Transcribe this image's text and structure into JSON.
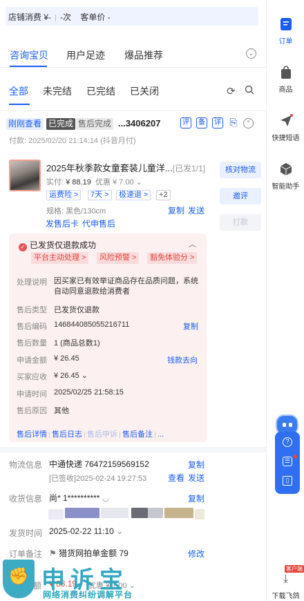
{
  "topbar": {
    "text1": "店铺消费 ¥-",
    "text2": "-次",
    "text3": "客单价 -"
  },
  "main_tabs": [
    {
      "label": "咨询宝贝",
      "active": true
    },
    {
      "label": "用户足迹",
      "active": false
    },
    {
      "label": "爆品推荐",
      "active": false
    }
  ],
  "order_tabs": [
    {
      "label": "全部",
      "active": true
    },
    {
      "label": "未完结",
      "active": false
    },
    {
      "label": "已完结",
      "active": false
    },
    {
      "label": "已关闭",
      "active": false
    }
  ],
  "order": {
    "badges": [
      "刚刚查看",
      "已完成",
      "售后完成"
    ],
    "order_no": "...3406207",
    "action_icons": [
      "评",
      "备",
      "详"
    ],
    "pay_time": "付款: 2025/02/20 21:14:14 (抖音月付)"
  },
  "product": {
    "title": "2025年秋季款女童套装儿童洋...",
    "shipped": "[已发1/1]",
    "price_label": "实付:",
    "price": "¥ 88.19",
    "discount": "优惠 ¥ 7.00",
    "tags": [
      "运费险 >",
      "7天 >",
      "极速退 >",
      "+2"
    ],
    "spec_label": "规格:",
    "spec": "黑色/130cm",
    "copy": "复制",
    "send": "发送",
    "card_link": "发售后卡",
    "agent_link": "代申售后"
  },
  "side_buttons": [
    "核对物流",
    "邀评",
    "打款"
  ],
  "refund": {
    "header": "已发货仅退款成功",
    "chips": [
      "平台主动处理 >",
      "风险预警 >",
      "豁免体验分 >"
    ],
    "rows": [
      {
        "label": "处理说明",
        "value": "因买家已有效举证商品存在品质问题，系统自动同意退款给消费者",
        "value2": "统自动同意退款给消费者"
      },
      {
        "label": "售后类型",
        "value": "已发货仅退款"
      },
      {
        "label": "售后编码",
        "value": "146844085055216711",
        "link": "复制"
      },
      {
        "label": "售后数量",
        "value": "1 (商品总数1)"
      },
      {
        "label": "申请金额",
        "value": "¥ 26.45",
        "link": "钱款去向"
      },
      {
        "label": "买家应收",
        "value": "¥ 26.45"
      },
      {
        "label": "申请时间",
        "value": "2025/02/25 21:58:15"
      },
      {
        "label": "售后原因",
        "value": "其他"
      }
    ],
    "footer": [
      "售后详情",
      "售后日志",
      "售后申诉",
      "售后备注",
      "..."
    ]
  },
  "logistics": {
    "label": "物流信息",
    "company": "中通快递 76472159569152",
    "status": "[已签收]2025-02-24 19:27:53",
    "copy": "复制",
    "view": "查看",
    "send": "发送"
  },
  "receiver": {
    "label": "收货信息",
    "value": "尚* 1**********",
    "copy": "复制"
  },
  "ship_time": {
    "label": "发货时间",
    "value": "2025-02-22 11:10"
  },
  "remark": {
    "label": "订单备注",
    "value": "猎货网拍单金额 79",
    "edit": "修改"
  },
  "bottom": {
    "amount_label": "额",
    "amount": "¥ 88.19",
    "discount": "优惠 ¥ 7.00"
  },
  "rightbar": {
    "items": [
      {
        "label": "订单",
        "icon": "order-icon"
      },
      {
        "label": "商品",
        "icon": "bag-icon"
      },
      {
        "label": "快捷短语",
        "icon": "send-icon"
      },
      {
        "label": "智能助手",
        "icon": "cube-icon"
      }
    ],
    "download": "下载飞鸽",
    "client_badge": "客户端"
  },
  "watermark": {
    "big": "申诉宝",
    "small": "网络消费纠纷调解平台"
  },
  "colors": {
    "accent": "#1a5df2",
    "refund_bg": "#fdf0f0",
    "danger": "#e0463c"
  }
}
